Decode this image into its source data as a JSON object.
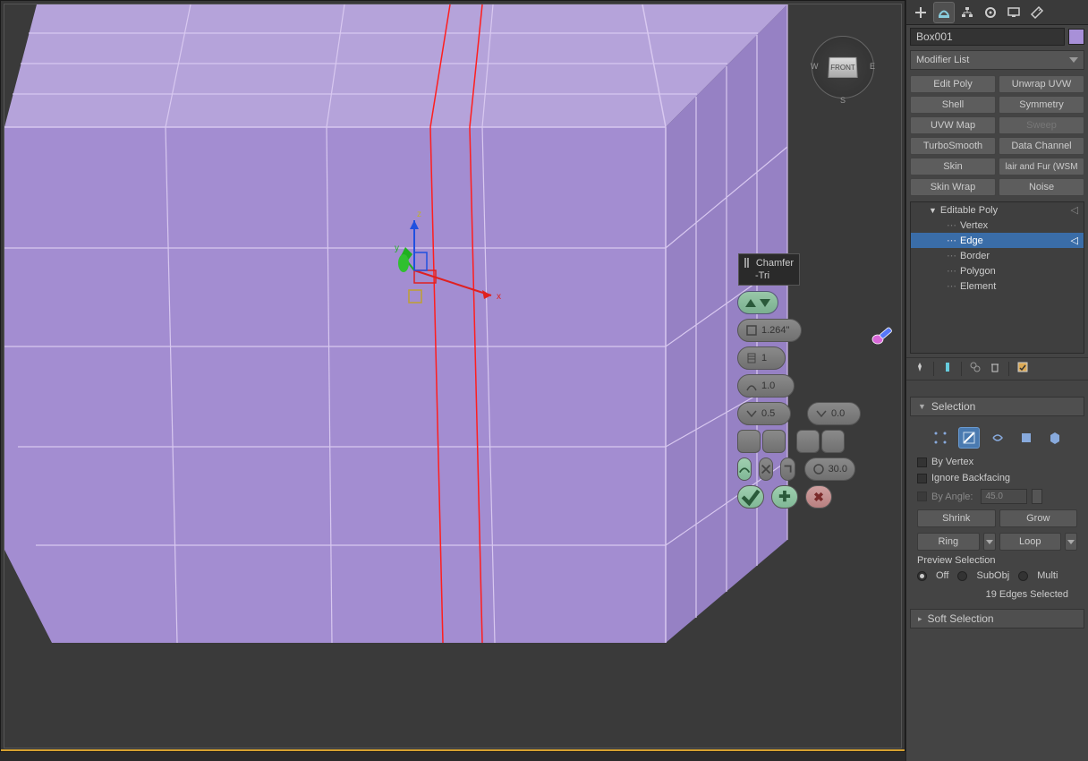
{
  "viewcube": {
    "face": "FRONT",
    "w": "W",
    "e": "E",
    "s": "S"
  },
  "tooltip": {
    "title": "Chamfer",
    "sub": "-Tri"
  },
  "caddy": {
    "amount": "1.264\"",
    "segments": "1",
    "tension": "1.0",
    "depth": "0.5",
    "depth2": "0.0",
    "miter": "30.0"
  },
  "object_name": "Box001",
  "modifier_list_label": "Modifier List",
  "modifier_buttons": [
    [
      "Edit Poly",
      "Unwrap UVW"
    ],
    [
      "Shell",
      "Symmetry"
    ],
    [
      "UVW Map",
      "Sweep"
    ],
    [
      "TurboSmooth",
      "Data Channel"
    ],
    [
      "Skin",
      "Hair and Fur (WSM)"
    ],
    [
      "Skin Wrap",
      "Noise"
    ]
  ],
  "stack": {
    "root": "Editable Poly",
    "items": [
      "Vertex",
      "Edge",
      "Border",
      "Polygon",
      "Element"
    ],
    "selected": "Edge"
  },
  "selection": {
    "title": "Selection",
    "by_vertex": "By Vertex",
    "ignore_backfacing": "Ignore Backfacing",
    "by_angle": "By Angle:",
    "angle_value": "45.0",
    "shrink": "Shrink",
    "grow": "Grow",
    "ring": "Ring",
    "loop": "Loop",
    "preview_label": "Preview Selection",
    "off": "Off",
    "subobj": "SubObj",
    "multi": "Multi",
    "status": "19 Edges Selected"
  },
  "soft_selection": {
    "title": "Soft Selection"
  }
}
